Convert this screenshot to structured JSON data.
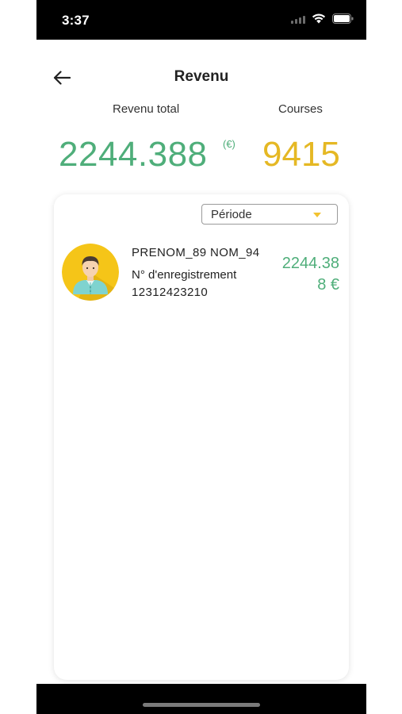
{
  "status_bar": {
    "time": "3:37"
  },
  "header": {
    "title": "Revenu"
  },
  "summary": {
    "revenue_label": "Revenu total",
    "courses_label": "Courses",
    "revenue_value": "2244.388",
    "revenue_unit": "(€)",
    "courses_value": "9415"
  },
  "filter": {
    "period_label": "Période"
  },
  "drivers": [
    {
      "name": "PRENOM_89 NOM_94",
      "registration_label": "N° d'enregistrement",
      "registration_number": "12312423210",
      "amount": "2244.388 €"
    }
  ],
  "colors": {
    "revenue_green": "#4fae7a",
    "courses_yellow": "#e5b824",
    "avatar_yellow": "#f5c518"
  }
}
